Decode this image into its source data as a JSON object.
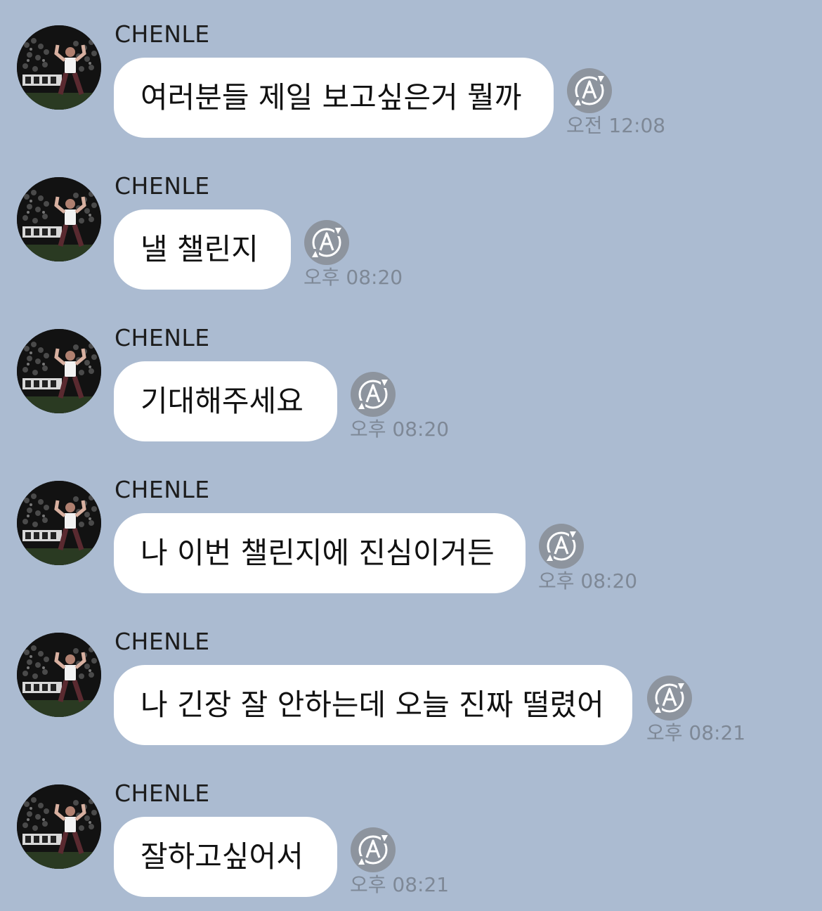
{
  "messages": [
    {
      "sender": "CHENLE",
      "text": "여러분들 제일 보고싶은거 뭘까",
      "time": "오전 12:08",
      "translate_icon": "auto-translate-icon"
    },
    {
      "sender": "CHENLE",
      "text": "낼 챌린지",
      "time": "오후 08:20",
      "translate_icon": "auto-translate-icon"
    },
    {
      "sender": "CHENLE",
      "text": "기대해주세요",
      "time": "오후 08:20",
      "translate_icon": "auto-translate-icon"
    },
    {
      "sender": "CHENLE",
      "text": "나 이번 챌린지에 진심이거든",
      "time": "오후 08:20",
      "translate_icon": "auto-translate-icon"
    },
    {
      "sender": "CHENLE",
      "text": "나 긴장 잘 안하는데 오늘 진짜 떨렸어",
      "time": "오후 08:21",
      "translate_icon": "auto-translate-icon"
    },
    {
      "sender": "CHENLE",
      "text": "잘하고싶어서",
      "time": "오후 08:21",
      "translate_icon": "auto-translate-icon"
    }
  ],
  "colors": {
    "background": "#abbbd1",
    "bubble": "#ffffff",
    "time_text": "#7e8896",
    "translate_icon_fill": "#8d949e"
  }
}
